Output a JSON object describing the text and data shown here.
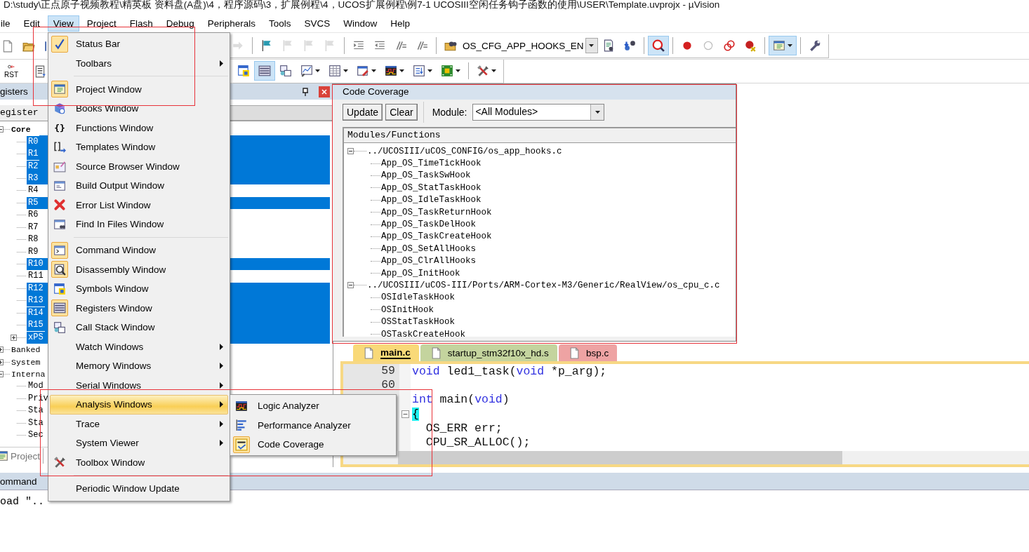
{
  "window": {
    "title": "D:\\study\\正点原子视频教程\\精英板 资料盘(A盘)\\4，程序源码\\3，扩展例程\\4，UCOS扩展例程\\例7-1 UCOSIII空闲任务钩子函数的使用\\USER\\Template.uvprojx - µVision"
  },
  "menubar": [
    {
      "label": "ile",
      "selected": false
    },
    {
      "label": "Edit",
      "selected": false
    },
    {
      "label": "View",
      "selected": true
    },
    {
      "label": "Project",
      "selected": false
    },
    {
      "label": "Flash",
      "selected": false
    },
    {
      "label": "Debug",
      "selected": false
    },
    {
      "label": "Peripherals",
      "selected": false
    },
    {
      "label": "Tools",
      "selected": false
    },
    {
      "label": "SVCS",
      "selected": false
    },
    {
      "label": "Window",
      "selected": false
    },
    {
      "label": "Help",
      "selected": false
    }
  ],
  "toolbar_1": {
    "left": [
      {
        "kind": "button",
        "pressed": false,
        "disabled": false,
        "dropdown": false
      },
      {
        "kind": "button",
        "pressed": false,
        "disabled": false,
        "dropdown": false
      },
      {
        "kind": "button",
        "pressed": false,
        "disabled": false,
        "dropdown": false
      }
    ],
    "right": [
      {
        "kind": "button",
        "pressed": false,
        "disabled": true,
        "dropdown": false
      },
      {
        "kind": "separator"
      },
      {
        "kind": "button",
        "pressed": false,
        "disabled": false,
        "dropdown": false
      },
      {
        "kind": "button",
        "pressed": false,
        "disabled": true,
        "dropdown": false
      },
      {
        "kind": "button",
        "pressed": false,
        "disabled": true,
        "dropdown": false
      },
      {
        "kind": "button",
        "pressed": false,
        "disabled": true,
        "dropdown": false
      },
      {
        "kind": "separator"
      },
      {
        "kind": "button",
        "pressed": false,
        "disabled": false,
        "dropdown": false
      },
      {
        "kind": "button",
        "pressed": false,
        "disabled": false,
        "dropdown": false
      },
      {
        "kind": "button",
        "pressed": false,
        "disabled": false,
        "dropdown": false
      },
      {
        "kind": "button",
        "pressed": false,
        "disabled": false,
        "dropdown": false
      },
      {
        "kind": "separator"
      },
      {
        "kind": "button",
        "pressed": false,
        "disabled": false,
        "dropdown": false
      },
      {
        "kind": "combo",
        "value": "OS_CFG_APP_HOOKS_EN"
      },
      {
        "kind": "button",
        "pressed": false,
        "disabled": false,
        "dropdown": false
      },
      {
        "kind": "button",
        "pressed": false,
        "disabled": false,
        "dropdown": false
      },
      {
        "kind": "separator"
      },
      {
        "kind": "button",
        "pressed": true,
        "disabled": false,
        "dropdown": false
      },
      {
        "kind": "separator"
      },
      {
        "kind": "button",
        "pressed": false,
        "disabled": false,
        "dropdown": false
      },
      {
        "kind": "button",
        "pressed": false,
        "disabled": false,
        "dropdown": false
      },
      {
        "kind": "button",
        "pressed": false,
        "disabled": false,
        "dropdown": false
      },
      {
        "kind": "button",
        "pressed": false,
        "disabled": false,
        "dropdown": false
      },
      {
        "kind": "separator"
      },
      {
        "kind": "button",
        "pressed": true,
        "disabled": false,
        "dropdown": true
      },
      {
        "kind": "separator"
      },
      {
        "kind": "button",
        "pressed": false,
        "disabled": false,
        "dropdown": false
      }
    ]
  },
  "toolbar_2": {
    "left": [
      {
        "kind": "button",
        "label": "RST",
        "pressed": false,
        "disabled": false,
        "dropdown": false
      },
      {
        "kind": "separator"
      },
      {
        "kind": "button",
        "pressed": false,
        "disabled": false,
        "dropdown": false
      }
    ],
    "right": [
      {
        "kind": "button",
        "pressed": false,
        "disabled": false,
        "dropdown": false
      },
      {
        "kind": "button",
        "pressed": true,
        "disabled": false,
        "dropdown": false
      },
      {
        "kind": "button",
        "pressed": false,
        "disabled": false,
        "dropdown": false
      },
      {
        "kind": "button",
        "pressed": false,
        "disabled": false,
        "dropdown": true
      },
      {
        "kind": "button",
        "pressed": false,
        "disabled": false,
        "dropdown": true
      },
      {
        "kind": "button",
        "pressed": false,
        "disabled": false,
        "dropdown": true
      },
      {
        "kind": "button",
        "pressed": false,
        "disabled": false,
        "dropdown": true
      },
      {
        "kind": "button",
        "pressed": false,
        "disabled": false,
        "dropdown": true
      },
      {
        "kind": "button",
        "pressed": false,
        "disabled": false,
        "dropdown": true
      },
      {
        "kind": "separator"
      },
      {
        "kind": "button",
        "pressed": false,
        "disabled": false,
        "dropdown": true
      }
    ]
  },
  "registers_pane": {
    "title": "gisters",
    "column": "egister",
    "tree": [
      {
        "label": "Core",
        "expanded": true,
        "children": [
          {
            "label": "R0",
            "selected": true
          },
          {
            "label": "R1",
            "selected": true
          },
          {
            "label": "R2",
            "selected": true
          },
          {
            "label": "R3",
            "selected": true
          },
          {
            "label": "R4",
            "selected": false
          },
          {
            "label": "R5",
            "selected": true
          },
          {
            "label": "R6",
            "selected": false
          },
          {
            "label": "R7",
            "selected": false
          },
          {
            "label": "R8",
            "selected": false
          },
          {
            "label": "R9",
            "selected": false
          },
          {
            "label": "R10",
            "selected": true
          },
          {
            "label": "R11",
            "selected": false
          },
          {
            "label": "R12",
            "selected": true
          },
          {
            "label": "R13",
            "selected": true
          },
          {
            "label": "R14",
            "selected": true
          },
          {
            "label": "R15",
            "selected": true
          },
          {
            "label": "xPS",
            "selected": true,
            "expanded": false
          }
        ]
      },
      {
        "label": "Banked",
        "expanded": false
      },
      {
        "label": "System",
        "expanded": false
      },
      {
        "label": "Interna",
        "expanded": true,
        "children": [
          {
            "label": "Mod",
            "selected": false
          },
          {
            "label": "Priv",
            "selected": false
          },
          {
            "label": "Sta",
            "selected": false
          },
          {
            "label": "Sta",
            "selected": false
          },
          {
            "label": "Sec",
            "selected": false
          }
        ]
      }
    ],
    "tabs": [
      {
        "label": "Project",
        "selected": false
      }
    ]
  },
  "command_pane": {
    "title": "ommand",
    "text": "oad \".."
  },
  "view_menu": [
    {
      "kind": "item",
      "label": "Status Bar",
      "checked": true,
      "submenu": false,
      "selected": false
    },
    {
      "kind": "item",
      "label": "Toolbars",
      "checked": false,
      "submenu": true,
      "selected": false
    },
    {
      "kind": "separator"
    },
    {
      "kind": "item",
      "label": "Project Window",
      "checked": true,
      "submenu": false,
      "selected": false
    },
    {
      "kind": "item",
      "label": "Books Window",
      "checked": false,
      "submenu": false,
      "selected": false
    },
    {
      "kind": "item",
      "label": "Functions Window",
      "checked": false,
      "submenu": false,
      "selected": false,
      "glyph": "{}"
    },
    {
      "kind": "item",
      "label": "Templates Window",
      "checked": false,
      "submenu": false,
      "selected": false
    },
    {
      "kind": "item",
      "label": "Source Browser Window",
      "checked": false,
      "submenu": false,
      "selected": false
    },
    {
      "kind": "item",
      "label": "Build Output Window",
      "checked": false,
      "submenu": false,
      "selected": false
    },
    {
      "kind": "item",
      "label": "Error List Window",
      "checked": false,
      "submenu": false,
      "selected": false
    },
    {
      "kind": "item",
      "label": "Find In Files Window",
      "checked": false,
      "submenu": false,
      "selected": false
    },
    {
      "kind": "separator"
    },
    {
      "kind": "item",
      "label": "Command Window",
      "checked": true,
      "submenu": false,
      "selected": false
    },
    {
      "kind": "item",
      "label": "Disassembly Window",
      "checked": true,
      "submenu": false,
      "selected": false
    },
    {
      "kind": "item",
      "label": "Symbols Window",
      "checked": false,
      "submenu": false,
      "selected": false
    },
    {
      "kind": "item",
      "label": "Registers Window",
      "checked": true,
      "submenu": false,
      "selected": false
    },
    {
      "kind": "item",
      "label": "Call Stack Window",
      "checked": false,
      "submenu": false,
      "selected": false
    },
    {
      "kind": "item",
      "label": "Watch Windows",
      "checked": false,
      "submenu": true,
      "selected": false
    },
    {
      "kind": "item",
      "label": "Memory Windows",
      "checked": false,
      "submenu": true,
      "selected": false
    },
    {
      "kind": "item",
      "label": "Serial Windows",
      "checked": false,
      "submenu": true,
      "selected": false
    },
    {
      "kind": "item",
      "label": "Analysis Windows",
      "checked": false,
      "submenu": true,
      "selected": true
    },
    {
      "kind": "item",
      "label": "Trace",
      "checked": false,
      "submenu": true,
      "selected": false
    },
    {
      "kind": "item",
      "label": "System Viewer",
      "checked": false,
      "submenu": true,
      "selected": false
    },
    {
      "kind": "item",
      "label": "Toolbox Window",
      "checked": false,
      "submenu": false,
      "selected": false
    },
    {
      "kind": "separator"
    },
    {
      "kind": "item",
      "label": "Periodic Window Update",
      "checked": false,
      "submenu": false,
      "selected": false
    }
  ],
  "analysis_submenu": [
    {
      "label": "Logic Analyzer",
      "checked": false
    },
    {
      "label": "Performance Analyzer",
      "checked": false
    },
    {
      "label": "Code Coverage",
      "checked": true
    }
  ],
  "code_coverage": {
    "title": "Code Coverage",
    "buttons": [
      "Update",
      "Clear"
    ],
    "module_label": "Module:",
    "module_value": "<All Modules>",
    "column": "Modules/Functions",
    "tree": [
      {
        "label": "../UCOSIII/uCOS_CONFIG/os_app_hooks.c",
        "expanded": true,
        "children": [
          {
            "label": "App_OS_TimeTickHook"
          },
          {
            "label": "App_OS_TaskSwHook"
          },
          {
            "label": "App_OS_StatTaskHook"
          },
          {
            "label": "App_OS_IdleTaskHook"
          },
          {
            "label": "App_OS_TaskReturnHook"
          },
          {
            "label": "App_OS_TaskDelHook"
          },
          {
            "label": "App_OS_TaskCreateHook"
          },
          {
            "label": "App_OS_SetAllHooks"
          },
          {
            "label": "App_OS_ClrAllHooks"
          },
          {
            "label": "App_OS_InitHook"
          }
        ]
      },
      {
        "label": "../UCOSIII/uCOS-III/Ports/ARM-Cortex-M3/Generic/RealView/os_cpu_c.c",
        "expanded": true,
        "children": [
          {
            "label": "OSIdleTaskHook"
          },
          {
            "label": "OSInitHook"
          },
          {
            "label": "OSStatTaskHook"
          },
          {
            "label": "OSTaskCreateHook"
          }
        ]
      }
    ]
  },
  "editor": {
    "tabs": [
      {
        "label": "main.c",
        "selected": true,
        "color": "#f9d978"
      },
      {
        "label": "startup_stm32f10x_hd.s",
        "selected": false,
        "color": "#c4d49e"
      },
      {
        "label": "bsp.c",
        "selected": false,
        "color": "#eea3a3"
      }
    ],
    "lines": [
      {
        "number": "59",
        "tokens": [
          {
            "kind": "keyword",
            "text": "void"
          },
          {
            "kind": "plain",
            "text": " led1_task("
          },
          {
            "kind": "keyword",
            "text": "void"
          },
          {
            "kind": "plain",
            "text": " *p_arg);"
          }
        ]
      },
      {
        "number": "60"
      },
      {
        "tokens": [
          {
            "kind": "keyword",
            "text": "int"
          },
          {
            "kind": "plain",
            "text": " main("
          },
          {
            "kind": "keyword",
            "text": "void"
          },
          {
            "kind": "plain",
            "text": ")"
          }
        ]
      },
      {
        "fold": true,
        "tokens": [
          {
            "kind": "brace-match",
            "text": "{"
          }
        ]
      },
      {
        "tokens": [
          {
            "kind": "plain",
            "text": "  OS_ERR err;"
          }
        ]
      },
      {
        "tokens": [
          {
            "kind": "plain",
            "text": "  CPU_SR_ALLOC();"
          }
        ]
      }
    ]
  }
}
